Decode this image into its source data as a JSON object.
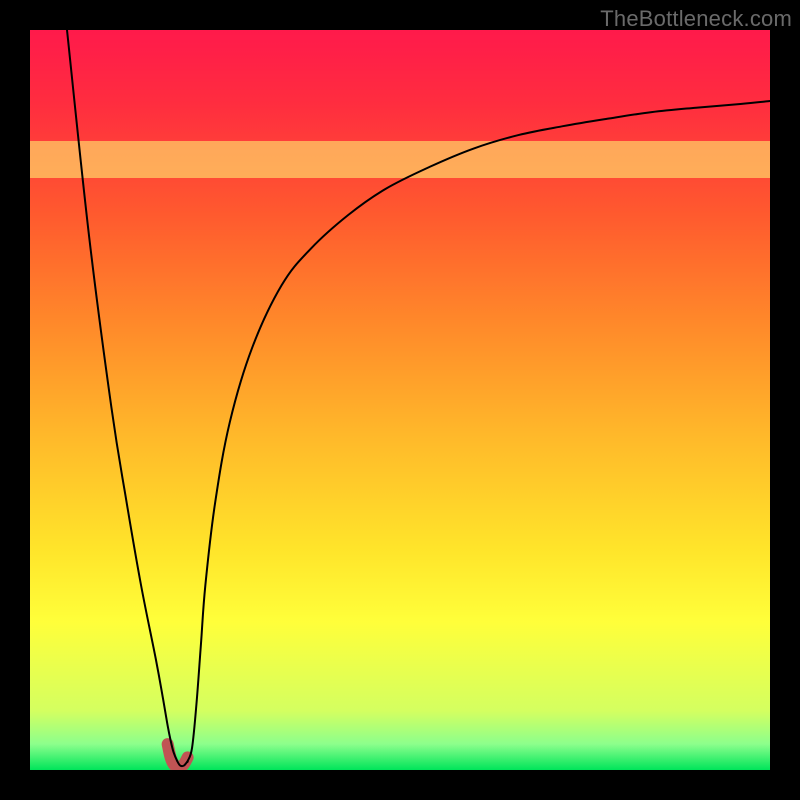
{
  "watermark": "TheBottleneck.com",
  "chart_data": {
    "type": "line",
    "title": "",
    "xlabel": "",
    "ylabel": "",
    "xlim": [
      0,
      100
    ],
    "ylim": [
      0,
      100
    ],
    "gradient_stops": [
      {
        "pos": 0.0,
        "color": "#ff1a4b"
      },
      {
        "pos": 0.1,
        "color": "#ff2d3f"
      },
      {
        "pos": 0.25,
        "color": "#ff5a2e"
      },
      {
        "pos": 0.4,
        "color": "#ff8a2a"
      },
      {
        "pos": 0.55,
        "color": "#ffb92a"
      },
      {
        "pos": 0.7,
        "color": "#ffe42a"
      },
      {
        "pos": 0.8,
        "color": "#ffff3a"
      },
      {
        "pos": 0.92,
        "color": "#d4ff60"
      },
      {
        "pos": 0.965,
        "color": "#8cff8c"
      },
      {
        "pos": 1.0,
        "color": "#00e55a"
      }
    ],
    "highlight_band": {
      "from": 80,
      "to": 85,
      "color": "#ffff77"
    },
    "series": [
      {
        "name": "curve",
        "x": [
          5.0,
          8.0,
          11.0,
          13.0,
          15.0,
          17.0,
          18.0,
          18.6,
          19.0,
          19.4,
          19.9,
          20.3,
          20.8,
          21.3,
          21.3,
          21.9,
          22.5,
          23.1,
          23.7,
          25.0,
          27.0,
          30.0,
          34.0,
          38.0,
          43.0,
          48.0,
          54.0,
          60.0,
          66.0,
          72.0,
          78.0,
          84.0,
          90.0,
          96.0,
          100.0
        ],
        "values": [
          100.0,
          72.0,
          49.0,
          36.5,
          25.0,
          15.0,
          9.5,
          6.0,
          4.0,
          2.4,
          1.2,
          0.6,
          0.6,
          1.2,
          1.2,
          3.0,
          9.0,
          17.0,
          25.0,
          36.0,
          47.0,
          57.0,
          65.5,
          70.5,
          75.0,
          78.5,
          81.5,
          84.0,
          85.8,
          87.0,
          88.0,
          88.9,
          89.5,
          90.0,
          90.4
        ]
      }
    ],
    "marker": {
      "name": "marker",
      "color": "#c05454",
      "stroke_width": 12,
      "x": [
        18.6,
        19.0,
        19.4,
        19.9,
        20.3,
        20.8,
        21.3
      ],
      "values": [
        3.5,
        1.7,
        0.8,
        0.4,
        0.4,
        0.8,
        1.7
      ]
    },
    "curve_color": "#000000",
    "curve_width": 2.0
  }
}
